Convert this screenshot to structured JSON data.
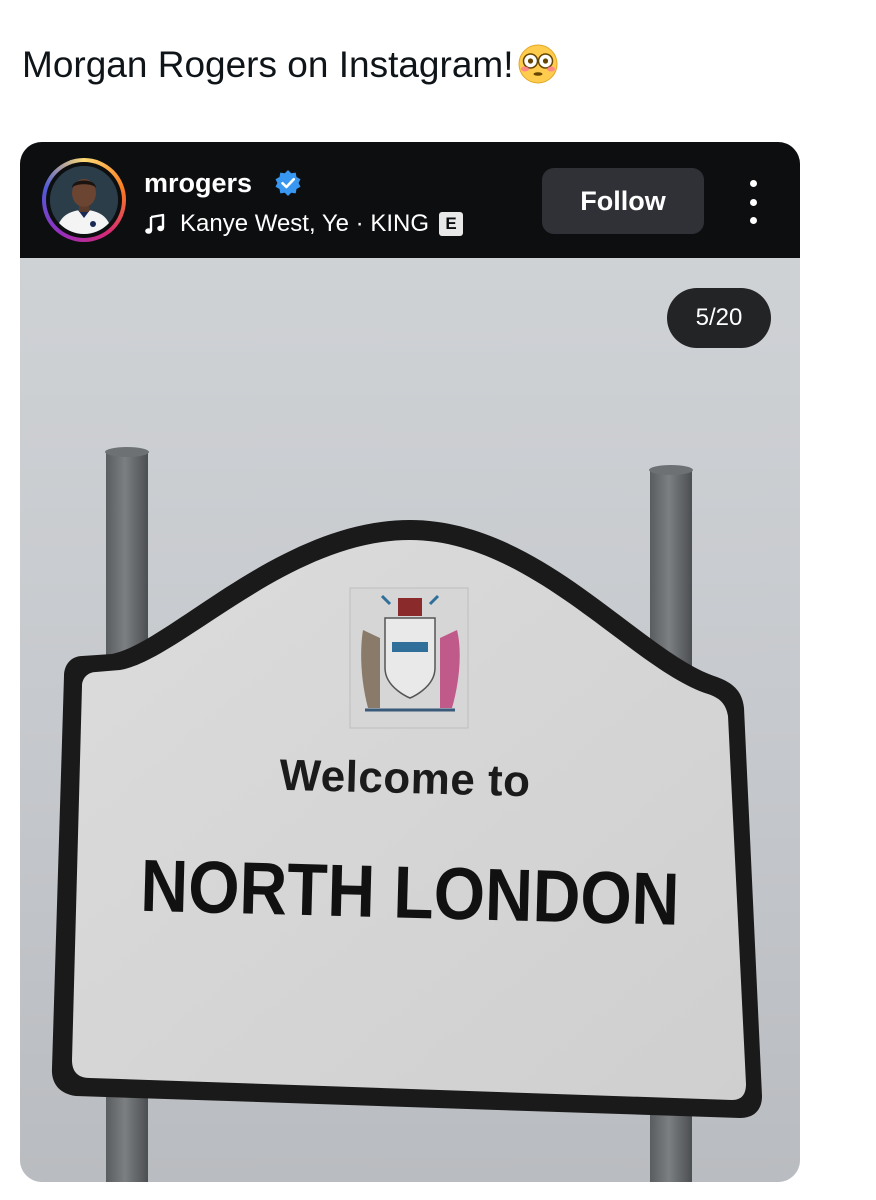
{
  "tweet": {
    "text": "Morgan Rogers on Instagram!",
    "emoji_icon": "flushed-face-emoji"
  },
  "instagram_post": {
    "username": "mrogers",
    "verified_icon": "verified-badge-icon",
    "music": {
      "icon": "music-note-icon",
      "track": "Kanye West, Ye · KING",
      "explicit_label": "E"
    },
    "follow_label": "Follow",
    "more_icon": "more-options-icon",
    "carousel_counter": "5/20",
    "sign": {
      "line1": "Welcome to",
      "line2": "NORTH LONDON"
    }
  },
  "colors": {
    "header_bg": "#0d0e10",
    "follow_bg": "#2f3136",
    "verified_blue": "#3897f0",
    "sky": "#c9cccf"
  }
}
